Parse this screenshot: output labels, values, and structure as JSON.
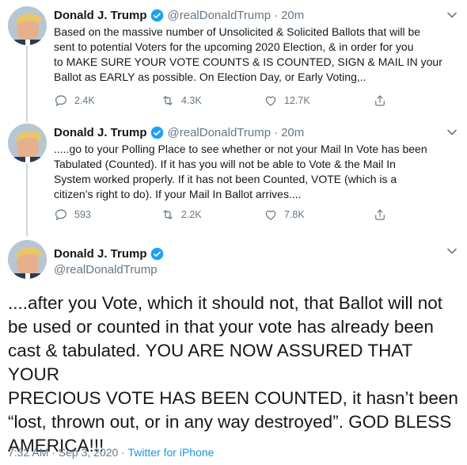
{
  "tweets": [
    {
      "name": "Donald J. Trump",
      "handle": "@realDonaldTrump",
      "separator": "·",
      "time": "20m",
      "text_lines": [
        "Based on the massive number of Unsolicited & Solicited Ballots that will be",
        "sent to potential Voters for the upcoming 2020 Election, & in order for you",
        "to MAKE SURE YOUR VOTE COUNTS & IS COUNTED, SIGN & MAIL IN your",
        "Ballot as EARLY as possible. On Election Day, or Early Voting,.."
      ],
      "replies": "2.4K",
      "retweets": "4.3K",
      "likes": "12.7K"
    },
    {
      "name": "Donald J. Trump",
      "handle": "@realDonaldTrump",
      "separator": "·",
      "time": "20m",
      "text_lines": [
        ".....go to your Polling Place to see whether or not your Mail In Vote has been",
        "Tabulated (Counted). If it has you will not be able to Vote & the Mail In",
        "System worked properly. If it has not been Counted, VOTE (which is a",
        "citizen’s right to do). If your Mail In Ballot arrives...."
      ],
      "replies": "593",
      "retweets": "2.2K",
      "likes": "7.8K"
    }
  ],
  "main_tweet": {
    "name": "Donald J. Trump",
    "handle": "@realDonaldTrump",
    "text_lines": [
      "....after you Vote, which it should not, that Ballot will not",
      "be used or counted in that your vote has already been",
      "cast & tabulated. YOU ARE NOW ASSURED THAT YOUR",
      "PRECIOUS VOTE HAS BEEN COUNTED, it hasn’t been",
      "“lost, thrown out, or in any way destroyed”. GOD BLESS",
      "AMERICA!!!"
    ],
    "timestamp": "7:32 AM · Sep 3, 2020 · ",
    "source": "Twitter for iPhone"
  },
  "icons": [
    "verified-badge-icon",
    "chevron-down-icon",
    "reply-icon",
    "retweet-icon",
    "like-icon",
    "share-icon"
  ],
  "colors": {
    "accent": "#1da1f2",
    "text": "#14171a",
    "secondary": "#657786",
    "thread_line": "#ccd6dd"
  }
}
